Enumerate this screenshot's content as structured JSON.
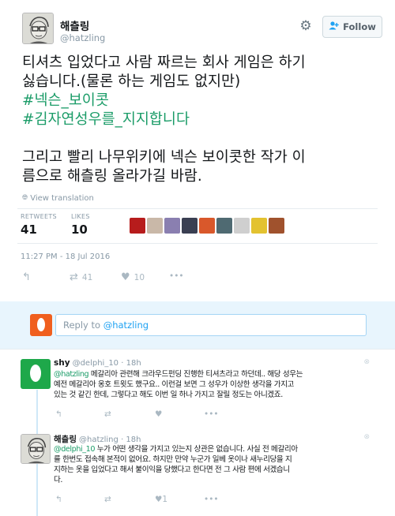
{
  "tweet": {
    "display_name": "해츨링",
    "handle": "@hatzling",
    "follow_label": "Follow",
    "text_lines": [
      "티셔츠 입었다고 사람 짜르는 회사 게임은 하기",
      "싫습니다.(물론 하는 게임도 없지만)"
    ],
    "hashtags": [
      "#넥슨_보이콧",
      "#김자연성우를_지지합니다"
    ],
    "text_lines_2": [
      "그리고 빨리 나무위키에 넥슨 보이콧한 작가 이",
      "름으로 해츨링 올라가길 바람."
    ],
    "view_translation": "View translation",
    "retweets_label": "RETWEETS",
    "retweets_count": "41",
    "likes_label": "LIKES",
    "likes_count": "10",
    "timestamp": "11:27 PM - 18 Jul 2016",
    "actions": {
      "retweet_count": "41",
      "like_count": "10",
      "more": "•••"
    },
    "liker_colors": [
      "#b71c1c",
      "#c9b8a8",
      "#8a7fb0",
      "#3a3f52",
      "#d9582b",
      "#4f6a72",
      "#cfcfcf",
      "#e3c230",
      "#a0522d"
    ]
  },
  "reply_box": {
    "placeholder_prefix": "Reply to ",
    "placeholder_handle": "@hatzling"
  },
  "replies": [
    {
      "name": "shy",
      "handle": "@delphi_10",
      "time": "· 18h",
      "mention": "@hatzling",
      "lines": [
        " 메갈리아 관련해 크라우드펀딩 진행한 티셔츠라고 하던데.. 해당 성우는",
        "예전 메갈리아 옹호 트윗도 했구요.. 이런걸 보면 그 성우가 이상한 생각을 가지고",
        "있는 것 같긴 한데, 그렇다고 해도 이번 일 하나 가지고 잘릴 정도는 아니겠죠."
      ],
      "like_count": "",
      "more": "•••"
    },
    {
      "name": "해츨링",
      "handle": "@hatzling",
      "time": "· 18h",
      "mention": "@delphi_10",
      "lines": [
        " 누가 어떤 생각을 가지고 있는지 상관은 없습니다. 사실 전 메갈리아",
        "를 한번도 접속해 본적이 없어요. 하지만 만약 누군가 일베 옷이나 새누리당을 지",
        "지하는 옷을 입었다고 해서 불이익을 당했다고 한다면 전 그 사람 편에 서겠습니",
        "다."
      ],
      "like_count": "1",
      "more": "•••"
    }
  ]
}
